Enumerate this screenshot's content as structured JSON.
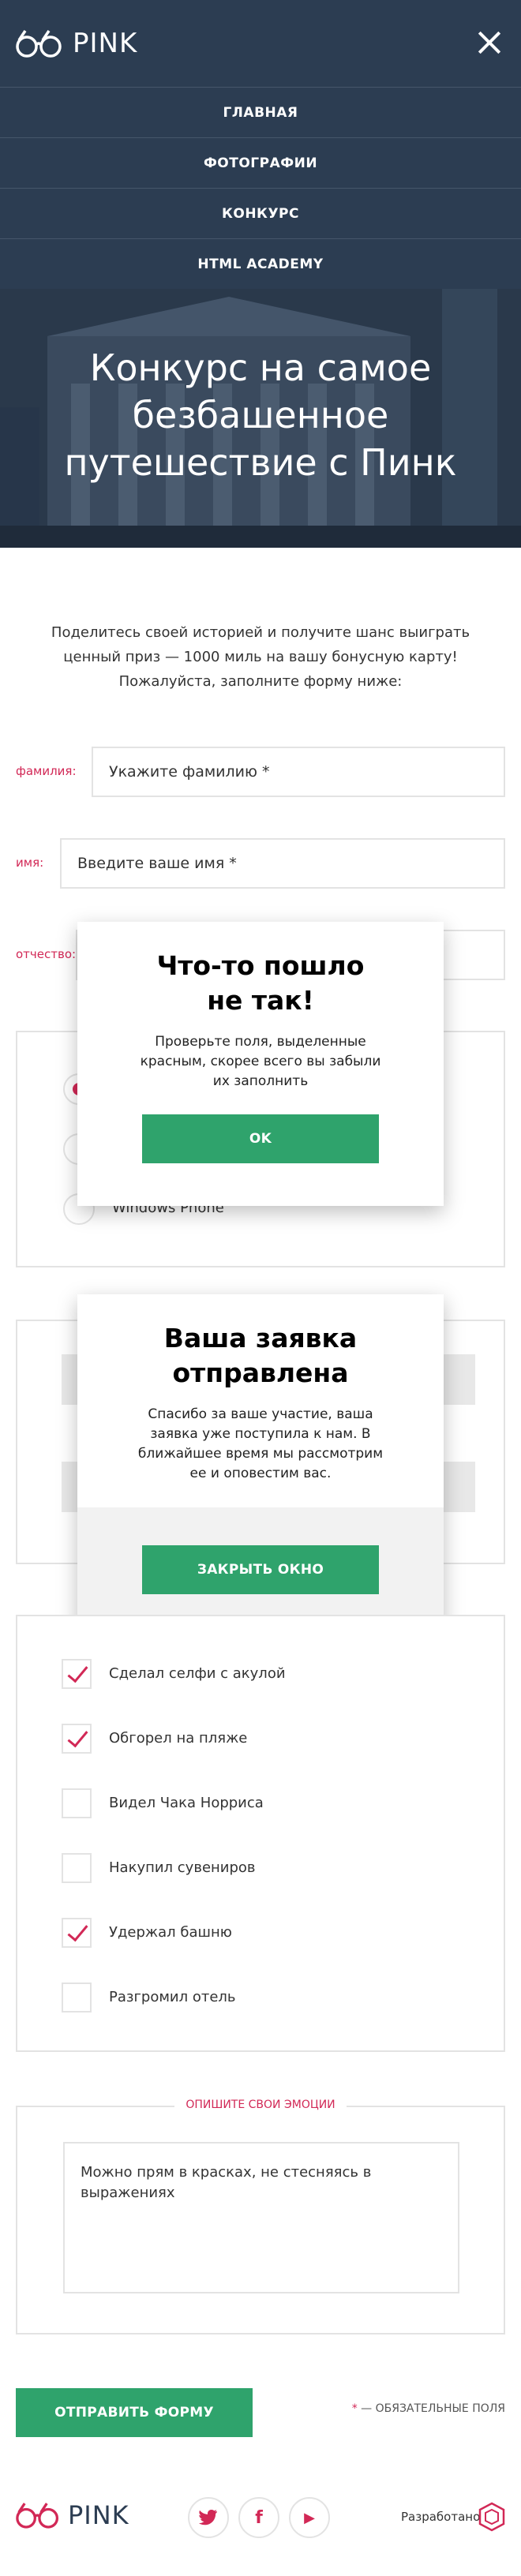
{
  "header": {
    "logo_text": "PINK",
    "nav": [
      "ГЛАВНАЯ",
      "ФОТОГРАФИИ",
      "КОНКУРС",
      "HTML ACADEMY"
    ]
  },
  "hero": {
    "title_line1": "Конкурс на самое",
    "title_line2": "безбашенное",
    "title_line3": "путешествие с Пинк"
  },
  "intro": {
    "line1": "Поделитесь своей историей и получите шанс выиграть",
    "line2": "ценный приз — 1000 миль на вашу бонусную карту!",
    "line3": "Пожалуйста, заполните форму ниже:"
  },
  "form": {
    "surname_label": "фамилия:",
    "surname_placeholder": "Укажите фамилию *",
    "name_label": "имя:",
    "name_placeholder": "Введите ваше имя *",
    "patronymic_label": "отчество:",
    "radio_partial_label": "Windows Phone",
    "checkboxes": [
      {
        "label": "Сделал селфи с акулой",
        "checked": true
      },
      {
        "label": "Обгорел на пляже",
        "checked": true
      },
      {
        "label": "Видел Чака Норриса",
        "checked": false
      },
      {
        "label": "Накупил сувениров",
        "checked": false
      },
      {
        "label": "Удержал башню",
        "checked": true
      },
      {
        "label": "Разгромил отель",
        "checked": false
      }
    ],
    "emotions_legend": "ОПИШИТЕ СВОИ ЭМОЦИИ",
    "emotions_placeholder": "Можно прям в красках, не стесняясь в выражениях",
    "submit_label": "ОТПРАВИТЬ ФОРМУ",
    "required_star": "*",
    "required_note": " — ОБЯЗАТЕЛЬНЫЕ ПОЛЯ"
  },
  "modal_error": {
    "title_line1": "Что-то пошло",
    "title_line2": "не так!",
    "text_line1": "Проверьте поля, выделенные",
    "text_line2": "красным, скорее всего вы забыли",
    "text_line3": "их заполнить",
    "button": "OK"
  },
  "modal_success": {
    "title_line1": "Ваша заявка",
    "title_line2": "отправлена",
    "text_line1": "Спасибо за ваше участие, ваша",
    "text_line2": "заявка уже поступила к нам. В",
    "text_line3": "ближайшее время мы рассмотрим",
    "text_line4": "ее и оповестим вас.",
    "button": "ЗАКРЫТЬ ОКНО"
  },
  "footer": {
    "logo_text": "PINK",
    "social": [
      {
        "icon": "twitter-icon",
        "glyph": "🐦"
      },
      {
        "icon": "facebook-icon",
        "glyph": "f"
      },
      {
        "icon": "youtube-icon",
        "glyph": "▶"
      }
    ],
    "developed_by": "Разработано"
  },
  "colors": {
    "accent": "#d22856",
    "navy": "#2c3d52",
    "green": "#2fa36c"
  }
}
